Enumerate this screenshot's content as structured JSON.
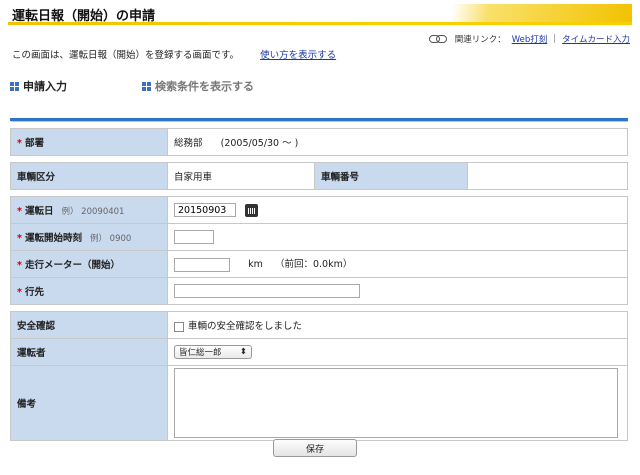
{
  "page": {
    "title": "運転日報（開始）の申請",
    "intro": "この画面は、運転日報（開始）を登録する画面です。",
    "help_link": "使い方を表示する"
  },
  "related": {
    "label": "関連リンク：",
    "links": [
      "Web打刻",
      "タイムカード入力"
    ],
    "separator": "|"
  },
  "tabs": {
    "active": "申請入力",
    "inactive": "検索条件を表示する"
  },
  "form": {
    "required_mark": "*",
    "department": {
      "label": "部署",
      "value": "総務部",
      "period": "(2005/05/30 ～ )"
    },
    "vehicle_type": {
      "label": "車輌区分",
      "value": "自家用車"
    },
    "vehicle_number": {
      "label": "車輌番号",
      "value": ""
    },
    "drive_date": {
      "label": "運転日",
      "example": "例） 20090401",
      "value": "20150903"
    },
    "start_time": {
      "label": "運転開始時刻",
      "example": "例） 0900",
      "value": ""
    },
    "odometer": {
      "label": "走行メーター（開始）",
      "unit": "km",
      "previous": "（前回：0.0km）",
      "value": ""
    },
    "destination": {
      "label": "行先",
      "value": ""
    },
    "safety_check": {
      "label": "安全確認",
      "checkbox_label": "車輌の安全確認をしました",
      "checked": false
    },
    "driver": {
      "label": "運転者",
      "selected": "皆仁総一郎",
      "arrow": "⬍"
    },
    "remarks": {
      "label": "備考",
      "value": ""
    }
  },
  "buttons": {
    "save": "保存"
  }
}
